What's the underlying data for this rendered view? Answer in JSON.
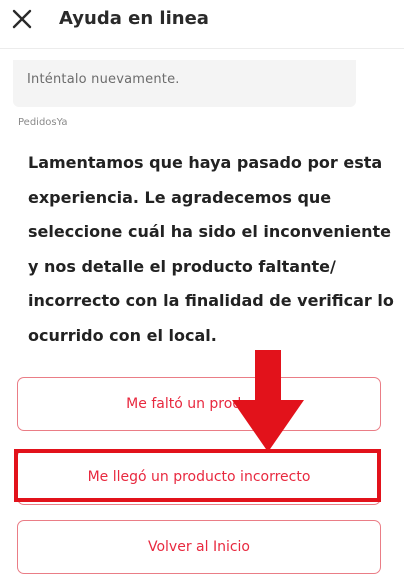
{
  "header": {
    "title": "Ayuda en linea",
    "close_icon": "close-icon"
  },
  "chat": {
    "previous_message": "Inténtalo nuevamente.",
    "sender": "PedidosYa",
    "message_lines": [
      "Lamentamos que haya pasado por esta",
      "experiencia. Le agradecemos que",
      "seleccione cuál ha sido el inconveniente",
      "y nos detalle el producto faltante/",
      "incorrecto con la finalidad de verificar lo",
      "ocurrido con el local."
    ]
  },
  "options": {
    "missing_product": "Me faltó un producto",
    "wrong_product": "Me llegó un producto incorrecto",
    "back_home": "Volver al Inicio"
  },
  "annotation": {
    "arrow_icon": "arrow-down-icon",
    "color": "#e2121b"
  },
  "colors": {
    "accent": "#e8293f",
    "button_border": "#ea7d86"
  }
}
